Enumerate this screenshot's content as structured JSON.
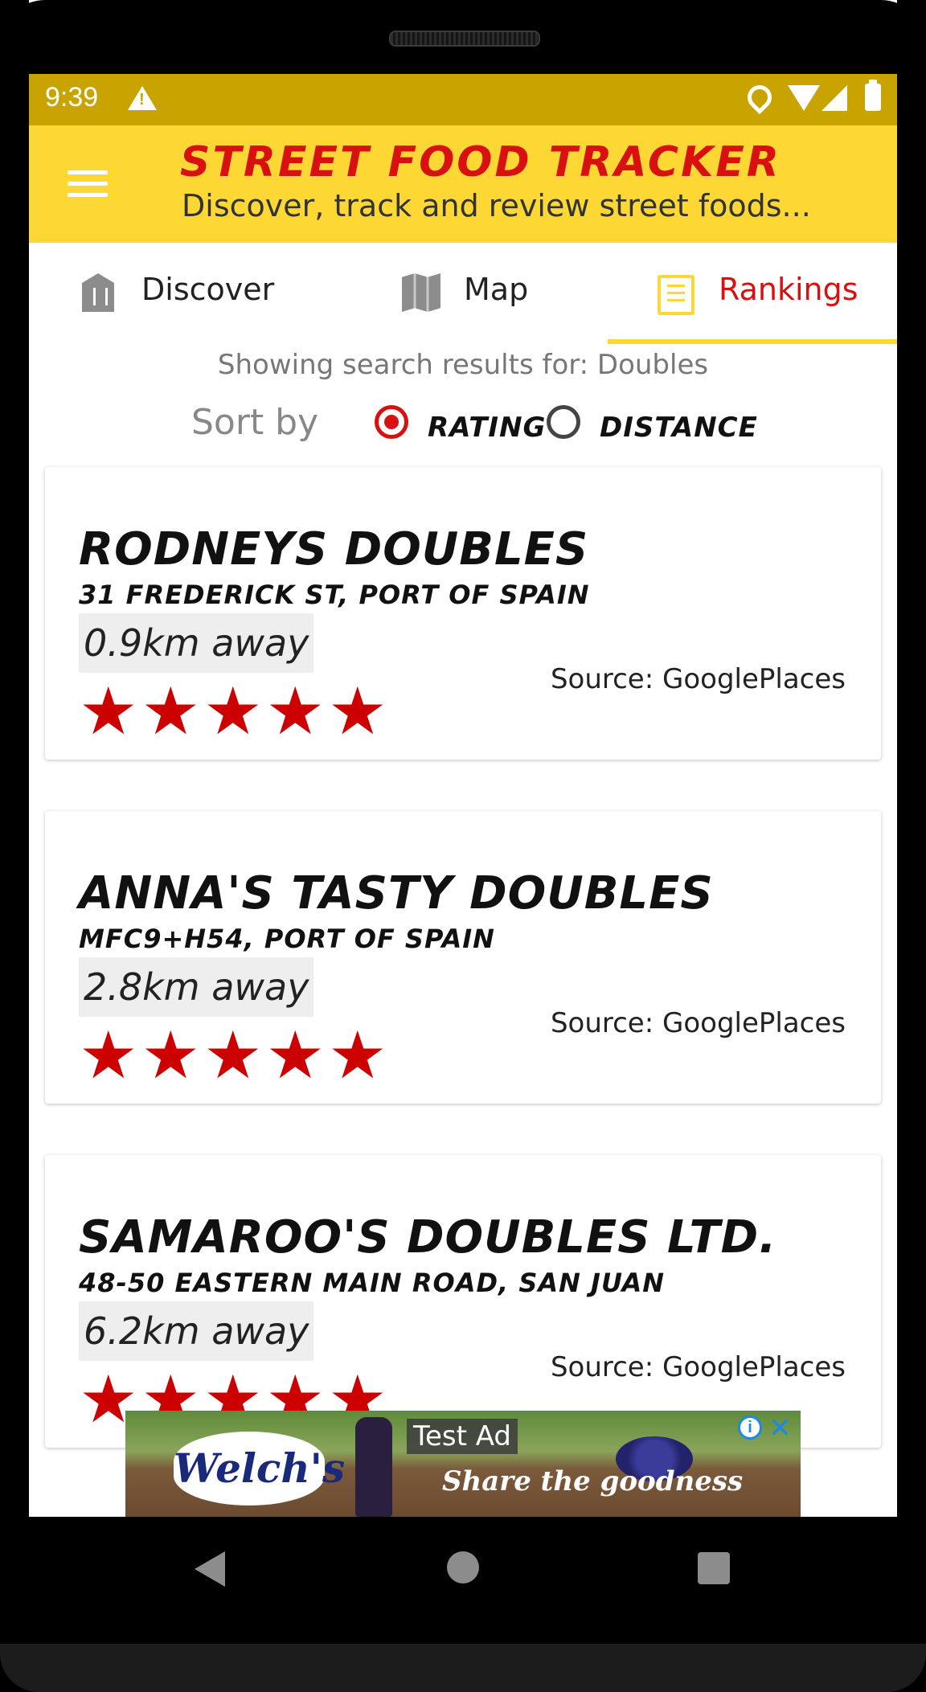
{
  "status_bar": {
    "time": "9:39"
  },
  "header": {
    "title": "STREET FOOD TRACKER",
    "subtitle": "Discover, track and review street foods..."
  },
  "tabs": [
    {
      "label": "Discover",
      "icon": "restaurant-icon",
      "selected": false
    },
    {
      "label": "Map",
      "icon": "map-icon",
      "selected": false
    },
    {
      "label": "Rankings",
      "icon": "list-icon",
      "selected": true
    }
  ],
  "search": {
    "caption": "Showing search results for: Doubles"
  },
  "sort": {
    "label": "Sort by",
    "options": [
      {
        "label": "RATING",
        "selected": true
      },
      {
        "label": "DISTANCE",
        "selected": false
      }
    ]
  },
  "results": [
    {
      "name": "RODNEYS DOUBLES",
      "address": "31 FREDERICK ST, PORT OF SPAIN",
      "distance": "0.9km away",
      "source": "Source: GooglePlaces",
      "stars": "★★★★★",
      "rating": 5
    },
    {
      "name": "ANNA'S TASTY DOUBLES",
      "address": "MFC9+H54, PORT OF SPAIN",
      "distance": "2.8km away",
      "source": "Source: GooglePlaces",
      "stars": "★★★★★",
      "rating": 5
    },
    {
      "name": "SAMAROO'S DOUBLES LTD.",
      "address": "48-50 EASTERN MAIN ROAD, SAN JUAN",
      "distance": "6.2km away",
      "source": "Source: GooglePlaces",
      "stars": "★★★★★",
      "rating": 5
    }
  ],
  "ad": {
    "label": "Test Ad",
    "brand": "Welch's",
    "tagline": "Share the goodness"
  },
  "colors": {
    "accent": "#fdd835",
    "title_red": "#d81010",
    "status_bar": "#c9a400",
    "star": "#cc0000"
  }
}
